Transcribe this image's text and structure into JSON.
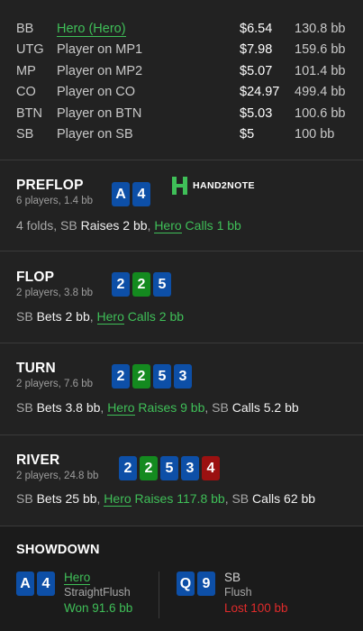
{
  "players": [
    {
      "pos": "BB",
      "name": "Hero (Hero)",
      "stack": "$6.54",
      "bb": "130.8 bb",
      "is_hero": true
    },
    {
      "pos": "UTG",
      "name": "Player on MP1",
      "stack": "$7.98",
      "bb": "159.6 bb",
      "is_hero": false
    },
    {
      "pos": "MP",
      "name": "Player on MP2",
      "stack": "$5.07",
      "bb": "101.4 bb",
      "is_hero": false
    },
    {
      "pos": "CO",
      "name": "Player on CO",
      "stack": "$24.97",
      "bb": "499.4 bb",
      "is_hero": false
    },
    {
      "pos": "BTN",
      "name": "Player on BTN",
      "stack": "$5.03",
      "bb": "100.6 bb",
      "is_hero": false
    },
    {
      "pos": "SB",
      "name": "Player on SB",
      "stack": "$5",
      "bb": "100 bb",
      "is_hero": false
    }
  ],
  "logo": {
    "text": "HAND2NOTE"
  },
  "preflop": {
    "name": "PREFLOP",
    "sub": "6 players, 1.4 bb",
    "cards": [
      "A",
      "4"
    ],
    "action": {
      "p1": "4 folds, SB ",
      "p2": "Raises 2 bb",
      "p3": ", ",
      "hero": "Hero",
      "p4": " Calls 1 bb"
    }
  },
  "flop": {
    "name": "FLOP",
    "sub": "2 players, 3.8 bb",
    "cards": [
      "2",
      "2",
      "5"
    ],
    "action": {
      "p1": "SB ",
      "p2": "Bets 2 bb",
      "p3": ", ",
      "hero": "Hero",
      "p4": " Calls 2 bb"
    }
  },
  "turn": {
    "name": "TURN",
    "sub": "2 players, 7.6 bb",
    "cards": [
      "2",
      "2",
      "5",
      "3"
    ],
    "action": {
      "p1": "SB ",
      "p2": "Bets 3.8 bb",
      "p3": ", ",
      "hero": "Hero",
      "p4": " Raises 9 bb",
      "p5": ", SB ",
      "p6": "Calls 5.2 bb"
    }
  },
  "river": {
    "name": "RIVER",
    "sub": "2 players, 24.8 bb",
    "cards": [
      "2",
      "2",
      "5",
      "3",
      "4"
    ],
    "action": {
      "p1": "SB ",
      "p2": "Bets 25 bb",
      "p3": ", ",
      "hero": "Hero",
      "p4": " Raises 117.8 bb",
      "p5": ", SB ",
      "p6": "Calls 62 bb"
    }
  },
  "showdown": {
    "title": "SHOWDOWN",
    "hero": {
      "cards": [
        "A",
        "4"
      ],
      "name": "Hero",
      "hand": "StraightFlush",
      "result": "Won 91.6 bb"
    },
    "villain": {
      "cards": [
        "Q",
        "9"
      ],
      "name": "SB",
      "hand": "Flush",
      "result": "Lost 100 bb"
    }
  },
  "colors": {
    "blue_card": "#0d4fa7",
    "green_card": "#148a1f",
    "red_card": "#9b1111",
    "hero_green": "#3fbf58",
    "lost_red": "#e02b2b"
  }
}
